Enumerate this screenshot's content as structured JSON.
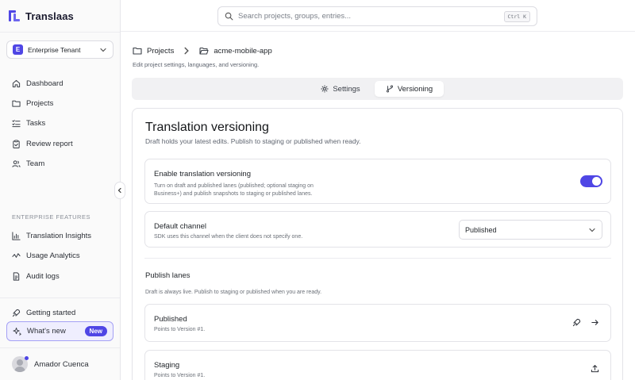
{
  "app": {
    "name": "Translaas"
  },
  "tenant": {
    "badge": "E",
    "name": "Enterprise Tenant"
  },
  "sidebar": {
    "items": [
      {
        "label": "Dashboard",
        "icon": "home-icon"
      },
      {
        "label": "Projects",
        "icon": "folder-icon"
      },
      {
        "label": "Tasks",
        "icon": "list-checks-icon"
      },
      {
        "label": "Review report",
        "icon": "clipboard-check-icon"
      },
      {
        "label": "Team",
        "icon": "users-icon"
      }
    ],
    "section_label": "ENTERPRISE FEATURES",
    "enterprise_items": [
      {
        "label": "Translation Insights",
        "icon": "bar-chart-icon"
      },
      {
        "label": "Usage Analytics",
        "icon": "activity-icon"
      },
      {
        "label": "Audit logs",
        "icon": "file-text-icon"
      }
    ],
    "getting_started": "Getting started",
    "whats_new": {
      "label": "What's new",
      "badge": "New"
    },
    "user": {
      "name": "Amador Cuenca"
    }
  },
  "search": {
    "placeholder": "Search projects, groups, entries...",
    "shortcut": "Ctrl K"
  },
  "breadcrumb": {
    "root": "Projects",
    "current": "acme-mobile-app"
  },
  "page": {
    "subtitle": "Edit project settings, languages, and versioning."
  },
  "tabs": [
    {
      "label": "Settings",
      "active": false
    },
    {
      "label": "Versioning",
      "active": true
    }
  ],
  "versioning": {
    "title": "Translation versioning",
    "description": "Draft holds your latest edits. Publish to staging or published when ready.",
    "enable": {
      "title": "Enable translation versioning",
      "description_line1": "Turn on draft and published lanes (published; optional staging on",
      "description_line2": "Business+) and publish snapshots to staging or published lanes.",
      "enabled": true
    },
    "default_channel": {
      "title": "Default channel",
      "description": "SDK uses this channel when the client does not specify one.",
      "value": "Published"
    },
    "publish_lanes": {
      "title": "Publish lanes",
      "description": "Draft is always live. Publish to staging or published when you are ready.",
      "lanes": [
        {
          "name": "Published",
          "points_to": "Points to Version #1."
        },
        {
          "name": "Staging",
          "points_to": "Points to Version #1."
        }
      ]
    }
  },
  "colors": {
    "accent": "#4f46e5",
    "accent_soft": "#efeefe"
  }
}
